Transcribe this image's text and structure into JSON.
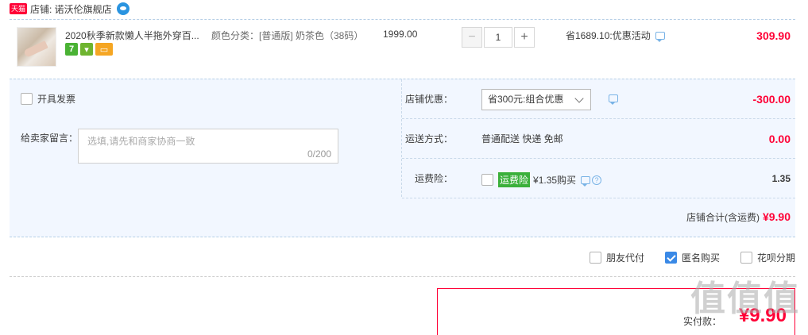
{
  "shop": {
    "badge": "天猫",
    "label": "店铺: 诺沃伦旗舰店"
  },
  "item": {
    "title": "2020秋季新款懒人半拖外穿百...",
    "tags": [
      "7"
    ],
    "sku": "颜色分类：[普通版] 奶茶色（38码）",
    "unit_price": "1999.00",
    "qty_minus": "−",
    "qty": "1",
    "qty_plus": "+",
    "promo": "省1689.10:优惠活动",
    "subtotal": "309.90"
  },
  "invoice_label": "开具发票",
  "memo": {
    "label": "给卖家留言：",
    "placeholder": "选填,请先和商家协商一致",
    "count": "0/200"
  },
  "coupon": {
    "label": "店铺优惠：",
    "selected": "省300元:组合优惠",
    "amount": "-300.00"
  },
  "shipping": {
    "label": "运送方式：",
    "text": "普通配送 快递 免邮",
    "amount": "0.00"
  },
  "insurance": {
    "label": "运费险：",
    "tag": "运费险",
    "text": "¥1.35购买",
    "help": "?",
    "amount": "1.35"
  },
  "shop_total": {
    "label": "店铺合计(含运费)",
    "amount": "¥9.90"
  },
  "options": [
    {
      "label": "朋友代付",
      "checked": false
    },
    {
      "label": "匿名购买",
      "checked": true
    },
    {
      "label": "花呗分期",
      "checked": false
    }
  ],
  "pay": {
    "label": "实付款：",
    "amount": "¥9.90"
  },
  "watermark": "值值值",
  "colors": {
    "accent": "#ff0036",
    "bg_block": "#f2f7ff",
    "check": "#3a89e6",
    "ins_tag": "#3bb03b"
  }
}
